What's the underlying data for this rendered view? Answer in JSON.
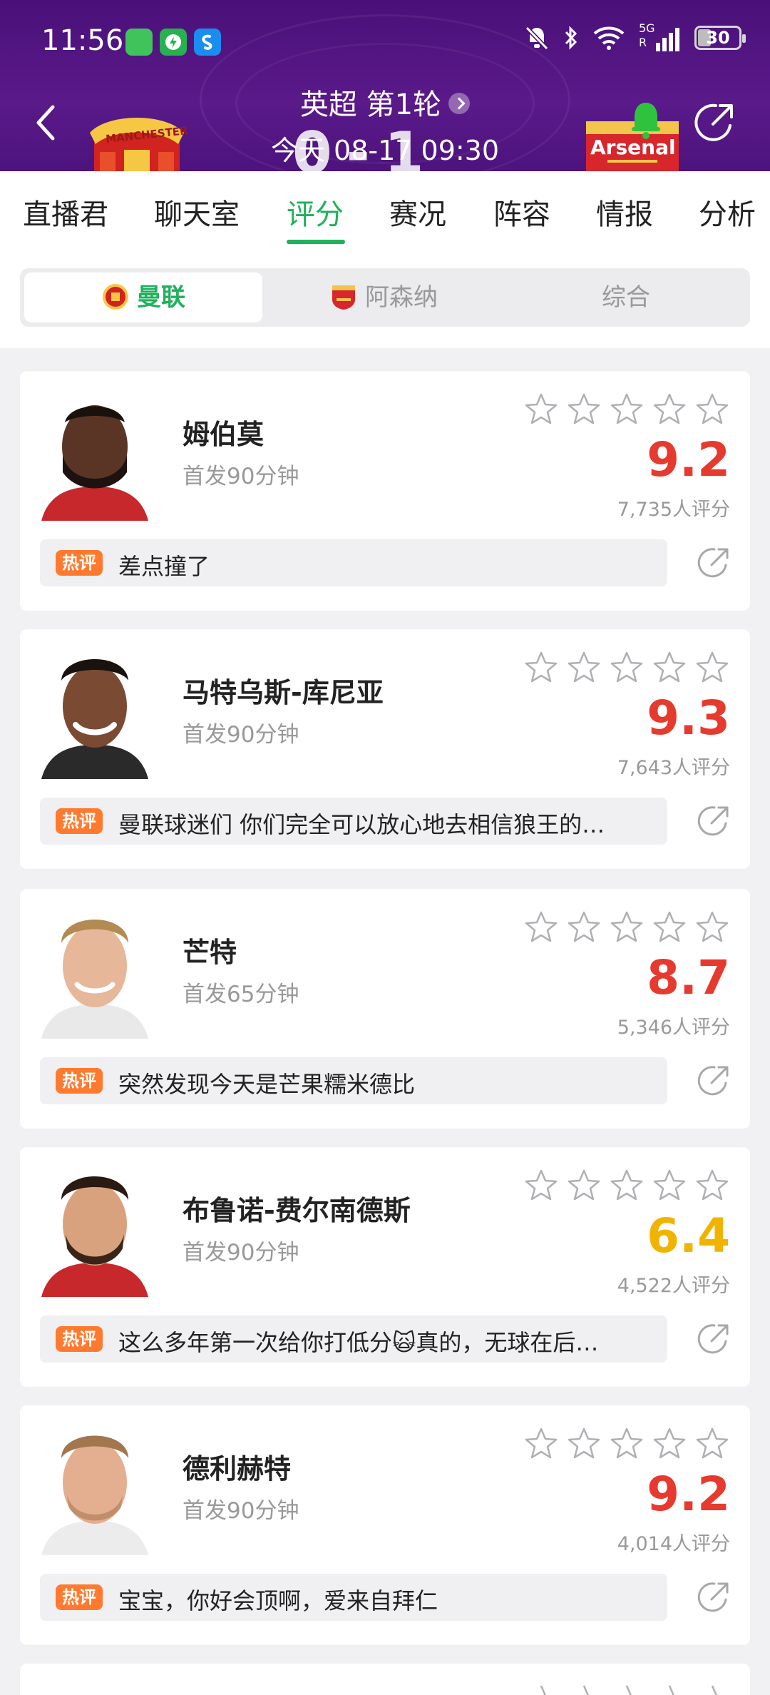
{
  "status_bar": {
    "time": "11:56",
    "network": "5G",
    "battery": "30"
  },
  "match": {
    "title": "英超 第1轮",
    "datetime": "今天 08-17 09:30",
    "score_home": "0",
    "score_sep": "-",
    "score_away": "1",
    "home_badge_text": "MANCHESTER",
    "away_badge_text": "Arsenal"
  },
  "tabs": [
    {
      "label": "直播君"
    },
    {
      "label": "聊天室"
    },
    {
      "label": "评分"
    },
    {
      "label": "赛况"
    },
    {
      "label": "阵容"
    },
    {
      "label": "情报"
    },
    {
      "label": "分析"
    }
  ],
  "active_tab": "评分",
  "team_selector": [
    {
      "label": "曼联",
      "icon": "man-utd-crest-icon"
    },
    {
      "label": "阿森纳",
      "icon": "arsenal-crest-icon"
    },
    {
      "label": "综合"
    }
  ],
  "hot_tag": "热评",
  "players": [
    {
      "name": "姆伯莫",
      "sub": "首发90分钟",
      "rating": "9.2",
      "votes": "7,735人评分",
      "comment": "差点撞了",
      "rating_color": "#e63a2e"
    },
    {
      "name": "马特乌斯-库尼亚",
      "sub": "首发90分钟",
      "rating": "9.3",
      "votes": "7,643人评分",
      "comment": "曼联球迷们 你们完全可以放心地去相信狼王的…",
      "rating_color": "#e63a2e"
    },
    {
      "name": "芒特",
      "sub": "首发65分钟",
      "rating": "8.7",
      "votes": "5,346人评分",
      "comment": "突然发现今天是芒果糯米德比",
      "rating_color": "#e63a2e"
    },
    {
      "name": "布鲁诺-费尔南德斯",
      "sub": "首发90分钟",
      "rating": "6.4",
      "votes": "4,522人评分",
      "comment": "这么多年第一次给你打低分🙀真的，无球在后…",
      "rating_color": "#f0b400"
    },
    {
      "name": "德利赫特",
      "sub": "首发90分钟",
      "rating": "9.2",
      "votes": "4,014人评分",
      "comment": "宝宝，你好会顶啊，爱来自拜仁",
      "rating_color": "#e63a2e"
    }
  ],
  "colors": {
    "header_purple": "#4a1078",
    "accent_green": "#1fb15b",
    "rating_red": "#e63a2e",
    "rating_yellow": "#f0b400",
    "hot_tag_orange": "#ff7a2f"
  }
}
